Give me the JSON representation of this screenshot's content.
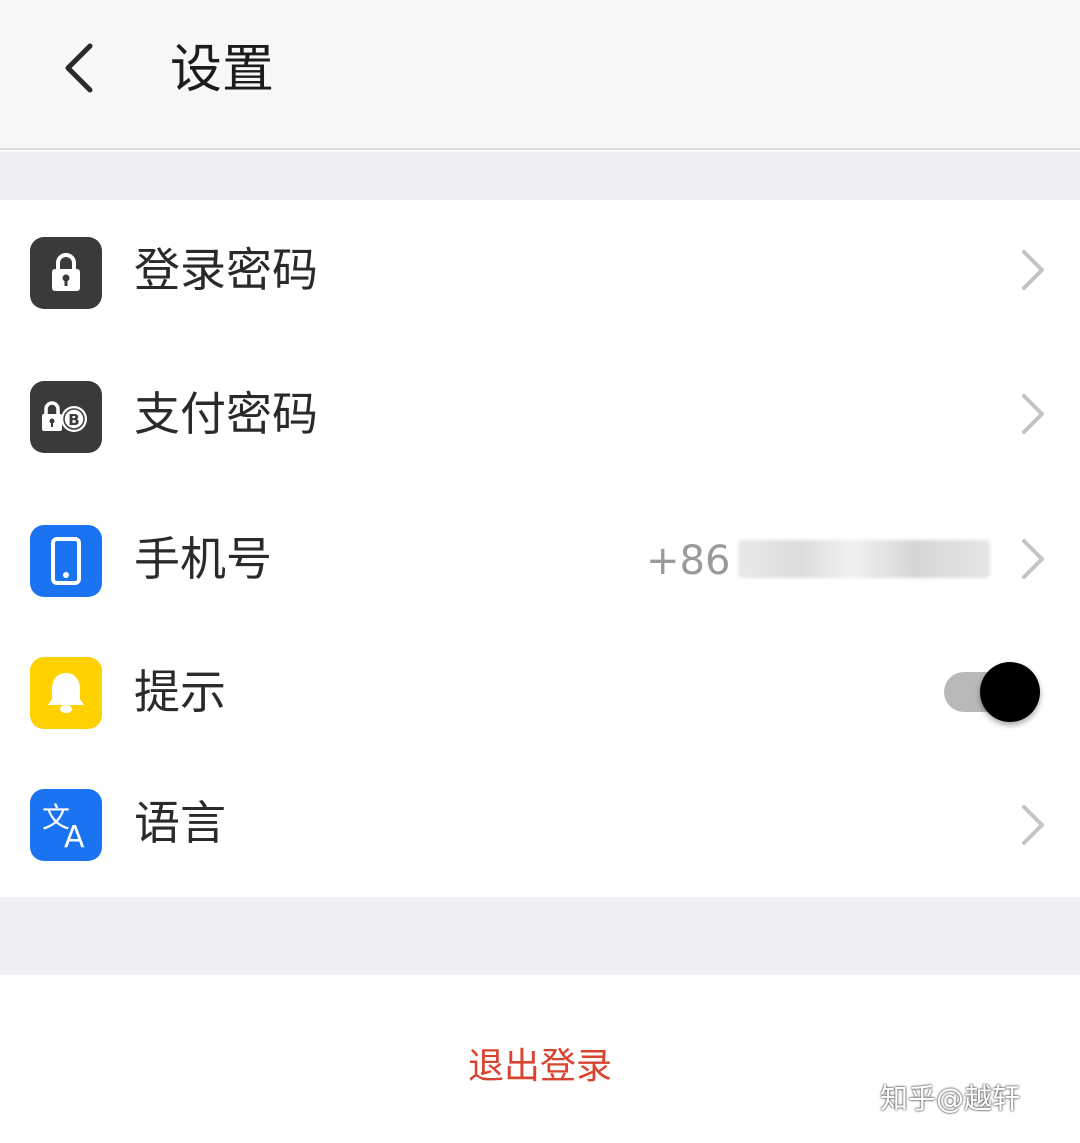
{
  "header": {
    "title": "设置",
    "back_icon": "chevron-left-icon"
  },
  "settings": {
    "items": [
      {
        "id": "login-password",
        "label": "登录密码",
        "icon": "lock-icon",
        "icon_color": "#3a3a3a"
      },
      {
        "id": "payment-password",
        "label": "支付密码",
        "icon": "payment-lock-icon",
        "icon_color": "#3a3a3a"
      },
      {
        "id": "phone-number",
        "label": "手机号",
        "value": "+86",
        "value_obscured": true,
        "icon": "phone-icon",
        "icon_color": "#1a73f0"
      },
      {
        "id": "notifications",
        "label": "提示",
        "icon": "bell-icon",
        "icon_color": "#ffd100",
        "toggle_on": true
      },
      {
        "id": "language",
        "label": "语言",
        "icon": "translate-icon",
        "icon_color": "#1a73f0"
      }
    ]
  },
  "footer": {
    "logout_label": "退出登录",
    "logout_color": "#d9432f"
  },
  "watermark": {
    "text": "知乎@越轩"
  }
}
